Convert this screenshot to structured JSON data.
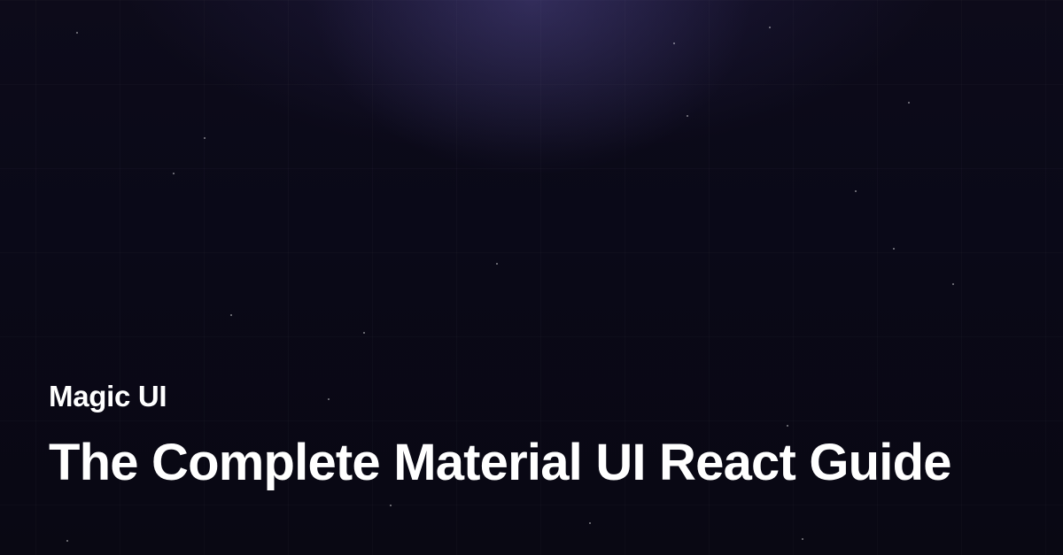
{
  "brand": "Magic UI",
  "title": "The Complete Material UI React Guide"
}
